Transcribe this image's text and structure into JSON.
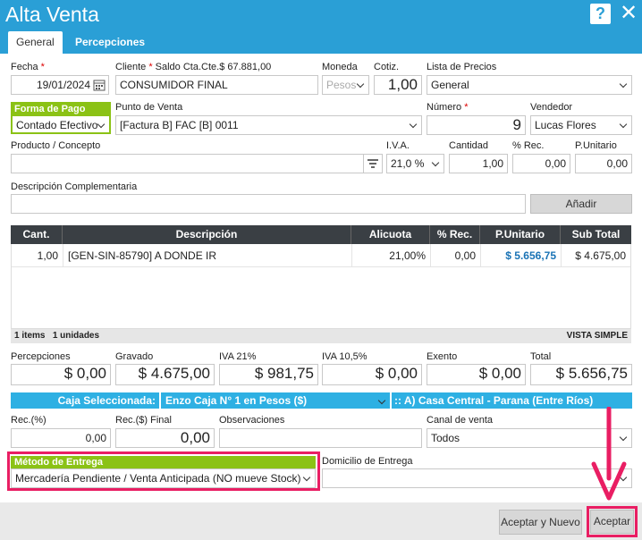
{
  "window": {
    "title": "Alta Venta",
    "help_icon": "?",
    "close_icon": "✕"
  },
  "tabs": [
    {
      "label": "General"
    },
    {
      "label": "Percepciones"
    }
  ],
  "fields": {
    "fecha": {
      "label": "Fecha",
      "value": "19/01/2024"
    },
    "cliente": {
      "label": "Cliente",
      "saldo": "Saldo Cta.Cte.$ 67.881,00",
      "value": "CONSUMIDOR FINAL"
    },
    "moneda": {
      "label": "Moneda",
      "value": "Pesos"
    },
    "cotiz": {
      "label": "Cotiz.",
      "value": "1,00"
    },
    "lista_precios": {
      "label": "Lista de Precios",
      "value": "General"
    },
    "forma_pago": {
      "label": "Forma de Pago",
      "value": "Contado Efectivo"
    },
    "punto_venta": {
      "label": "Punto de Venta",
      "value": "[Factura B] FAC [B] 0011"
    },
    "numero": {
      "label": "Número",
      "value": "9"
    },
    "vendedor": {
      "label": "Vendedor",
      "value": "Lucas Flores"
    },
    "producto": {
      "label": "Producto / Concepto",
      "value": ""
    },
    "iva": {
      "label": "I.V.A.",
      "value": "21,0 %"
    },
    "cantidad": {
      "label": "Cantidad",
      "value": "1,00"
    },
    "rec": {
      "label": "% Rec.",
      "value": "0,00"
    },
    "punitario": {
      "label": "P.Unitario",
      "value": "0,00"
    },
    "desc_comp": {
      "label": "Descripción Complementaria",
      "value": ""
    },
    "anadir": "Añadir"
  },
  "grid": {
    "headers": [
      "Cant.",
      "Descripción",
      "Alicuota",
      "% Rec.",
      "P.Unitario",
      "Sub Total"
    ],
    "rows": [
      {
        "cant": "1,00",
        "desc": "[GEN-SIN-85790] A DONDE IR",
        "alic": "21,00%",
        "rec": "0,00",
        "punit": "$ 5.656,75",
        "sub": "$ 4.675,00"
      }
    ],
    "footer_items": "1 items",
    "footer_units": "1 unidades",
    "footer_view": "VISTA SIMPLE"
  },
  "totals": {
    "percepciones": {
      "label": "Percepciones",
      "value": "$ 0,00"
    },
    "gravado": {
      "label": "Gravado",
      "value": "$ 4.675,00"
    },
    "iva21": {
      "label": "IVA 21%",
      "value": "$ 981,75"
    },
    "iva105": {
      "label": "IVA 10,5%",
      "value": "$ 0,00"
    },
    "exento": {
      "label": "Exento",
      "value": "$ 0,00"
    },
    "total": {
      "label": "Total",
      "value": "$ 5.656,75"
    }
  },
  "caja": {
    "label": "Caja Seleccionada:",
    "value": "Enzo Caja N° 1 en Pesos ($)",
    "sucursal": ":: A) Casa Central - Parana (Entre Ríos)"
  },
  "rec_fields": {
    "rec_pct": {
      "label": "Rec.(%)",
      "value": "0,00"
    },
    "rec_final": {
      "label": "Rec.($) Final",
      "value": "0,00"
    },
    "observaciones": {
      "label": "Observaciones",
      "value": ""
    },
    "canal": {
      "label": "Canal de venta",
      "value": "Todos"
    }
  },
  "entrega": {
    "metodo_label": "Método de Entrega",
    "metodo_value": "Mercadería Pendiente / Venta Anticipada (NO mueve Stock)",
    "domicilio_label": "Domicilio de Entrega",
    "domicilio_value": ""
  },
  "buttons": {
    "aceptar_nuevo": "Aceptar y Nuevo",
    "aceptar": "Aceptar"
  },
  "colors": {
    "header": "#2a9fd6",
    "green": "#8bc215",
    "highlight": "#e91e63",
    "blue_link": "#1a73b5"
  }
}
